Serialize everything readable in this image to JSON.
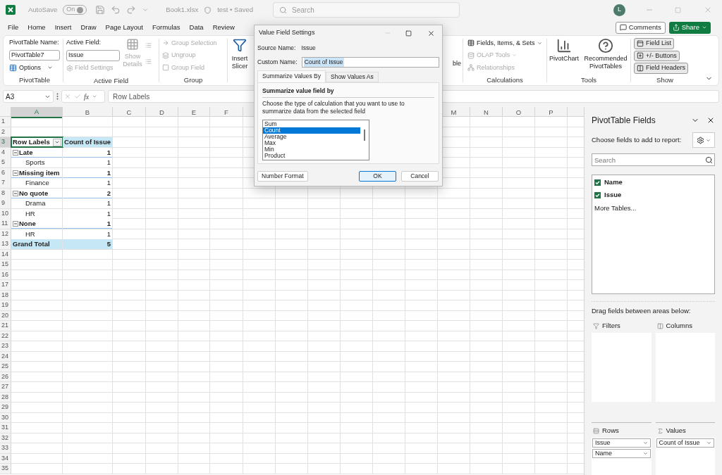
{
  "title_bar": {
    "autosave_label": "AutoSave",
    "autosave_toggle": "On",
    "file_name": "Book1.xlsx",
    "file_status": "test • Saved",
    "search_placeholder": "Search",
    "avatar": "L"
  },
  "menu": [
    "File",
    "Home",
    "Insert",
    "Draw",
    "Page Layout",
    "Formulas",
    "Data",
    "Review"
  ],
  "actions": {
    "comments": "Comments",
    "share": "Share"
  },
  "ribbon": {
    "pivottable": {
      "name_label": "PivotTable Name:",
      "name_value": "PivotTable7",
      "options": "Options",
      "group_label": "PivotTable"
    },
    "active_field": {
      "label": "Active Field:",
      "value": "Issue",
      "field_settings": {
        "label": "Field Settings",
        "disabled": true
      },
      "show_details": {
        "label": "Show Details",
        "disabled": true
      },
      "group_label": "Active Field"
    },
    "group": {
      "items": [
        {
          "label": "Group Selection",
          "disabled": true
        },
        {
          "label": "Ungroup",
          "disabled": true
        },
        {
          "label": "Group Field",
          "disabled": true
        }
      ],
      "group_label": "Group"
    },
    "insert_slicer": "Insert Slicer",
    "covered_fragment": "ble",
    "calculations": {
      "items": [
        {
          "label": "Fields, Items, & Sets",
          "disabled": false
        },
        {
          "label": "OLAP Tools",
          "disabled": true
        },
        {
          "label": "Relationships",
          "disabled": true
        }
      ],
      "group_label": "Calculations"
    },
    "tools": {
      "items": [
        "PivotChart",
        "Recommended PivotTables"
      ],
      "group_label": "Tools"
    },
    "show": {
      "items": [
        {
          "label": "Field List",
          "selected": true
        },
        {
          "label": "+/- Buttons",
          "selected": true
        },
        {
          "label": "Field Headers",
          "selected": true
        }
      ],
      "group_label": "Show"
    }
  },
  "formula_bar": {
    "name_box": "A3",
    "function_symbol": "fx",
    "formula": "Row Labels"
  },
  "sheet": {
    "columns_left": [
      {
        "label": "A",
        "selected": true
      },
      {
        "label": "B",
        "selected": false
      },
      {
        "label": "C",
        "selected": false
      },
      {
        "label": "D",
        "selected": false
      },
      {
        "label": "E",
        "selected": false
      },
      {
        "label": "F",
        "selected": false
      }
    ],
    "columns_right": [
      {
        "label": "M",
        "selected": false
      },
      {
        "label": "N",
        "selected": false
      },
      {
        "label": "O",
        "selected": false
      },
      {
        "label": "P",
        "selected": false
      }
    ],
    "rows": [
      {
        "number": "1",
        "kind": "empty",
        "selected": false
      },
      {
        "number": "2",
        "kind": "empty",
        "selected": false
      },
      {
        "number": "3",
        "kind": "header",
        "a": "Row Labels",
        "b": "Count of Issue",
        "selected": true
      },
      {
        "number": "4",
        "kind": "group",
        "a": "Late",
        "b": "1",
        "expanded": true,
        "selected": false
      },
      {
        "number": "5",
        "kind": "item",
        "a": "Sports",
        "b": "1",
        "selected": false
      },
      {
        "number": "6",
        "kind": "group",
        "a": "Missing item",
        "b": "1",
        "expanded": true,
        "selected": false
      },
      {
        "number": "7",
        "kind": "item",
        "a": "Finance",
        "b": "1",
        "selected": false
      },
      {
        "number": "8",
        "kind": "group",
        "a": "No quote",
        "b": "2",
        "expanded": true,
        "selected": false
      },
      {
        "number": "9",
        "kind": "item",
        "a": "Drama",
        "b": "1",
        "selected": false
      },
      {
        "number": "10",
        "kind": "item",
        "a": "HR",
        "b": "1",
        "selected": false
      },
      {
        "number": "11",
        "kind": "group",
        "a": "None",
        "b": "1",
        "expanded": true,
        "selected": false
      },
      {
        "number": "12",
        "kind": "item",
        "a": "HR",
        "b": "1",
        "selected": false
      },
      {
        "number": "13",
        "kind": "total",
        "a": "Grand Total",
        "b": "5",
        "selected": false
      },
      {
        "number": "14",
        "kind": "empty",
        "selected": false
      },
      {
        "number": "15",
        "kind": "empty",
        "selected": false
      },
      {
        "number": "16",
        "kind": "empty",
        "selected": false
      },
      {
        "number": "17",
        "kind": "empty",
        "selected": false
      },
      {
        "number": "18",
        "kind": "empty",
        "selected": false
      },
      {
        "number": "19",
        "kind": "empty",
        "selected": false
      },
      {
        "number": "20",
        "kind": "empty",
        "selected": false
      },
      {
        "number": "21",
        "kind": "empty",
        "selected": false
      },
      {
        "number": "22",
        "kind": "empty",
        "selected": false
      },
      {
        "number": "23",
        "kind": "empty",
        "selected": false
      },
      {
        "number": "24",
        "kind": "empty",
        "selected": false
      },
      {
        "number": "25",
        "kind": "empty",
        "selected": false
      },
      {
        "number": "26",
        "kind": "empty",
        "selected": false
      },
      {
        "number": "27",
        "kind": "empty",
        "selected": false
      },
      {
        "number": "28",
        "kind": "empty",
        "selected": false
      },
      {
        "number": "29",
        "kind": "empty",
        "selected": false
      },
      {
        "number": "30",
        "kind": "empty",
        "selected": false
      },
      {
        "number": "31",
        "kind": "empty",
        "selected": false
      },
      {
        "number": "32",
        "kind": "empty",
        "selected": false
      },
      {
        "number": "33",
        "kind": "empty",
        "selected": false
      },
      {
        "number": "34",
        "kind": "empty",
        "selected": false
      },
      {
        "number": "35",
        "kind": "empty",
        "selected": false
      }
    ]
  },
  "dialog": {
    "title": "Value Field Settings",
    "source_label": "Source Name:",
    "source_value": "Issue",
    "custom_label": "Custom Name:",
    "custom_value": "Count of Issue",
    "tabs": [
      {
        "label": "Summarize Values By",
        "selected": true
      },
      {
        "label": "Show Values As",
        "selected": false
      }
    ],
    "heading": "Summarize value field by",
    "description": "Choose the type of calculation that you want to use to summarize data from the selected field",
    "options": [
      {
        "label": "Sum",
        "selected": false
      },
      {
        "label": "Count",
        "selected": true
      },
      {
        "label": "Average",
        "selected": false
      },
      {
        "label": "Max",
        "selected": false
      },
      {
        "label": "Min",
        "selected": false
      },
      {
        "label": "Product",
        "selected": false
      }
    ],
    "number_format": "Number Format",
    "ok": "OK",
    "cancel": "Cancel"
  },
  "pane": {
    "title": "PivotTable Fields",
    "subtitle": "Choose fields to add to report:",
    "search_placeholder": "Search",
    "fields": [
      {
        "label": "Name",
        "checked": true
      },
      {
        "label": "Issue",
        "checked": true
      }
    ],
    "more_tables": "More Tables...",
    "drag_hint": "Drag fields between areas below:",
    "areas": [
      {
        "kind": "filters",
        "label": "Filters"
      },
      {
        "kind": "columns",
        "label": "Columns"
      },
      {
        "kind": "rows",
        "label": "Rows",
        "items": [
          "Issue",
          "Name"
        ]
      },
      {
        "kind": "values",
        "label": "Values",
        "items": [
          "Count of Issue"
        ]
      }
    ]
  }
}
